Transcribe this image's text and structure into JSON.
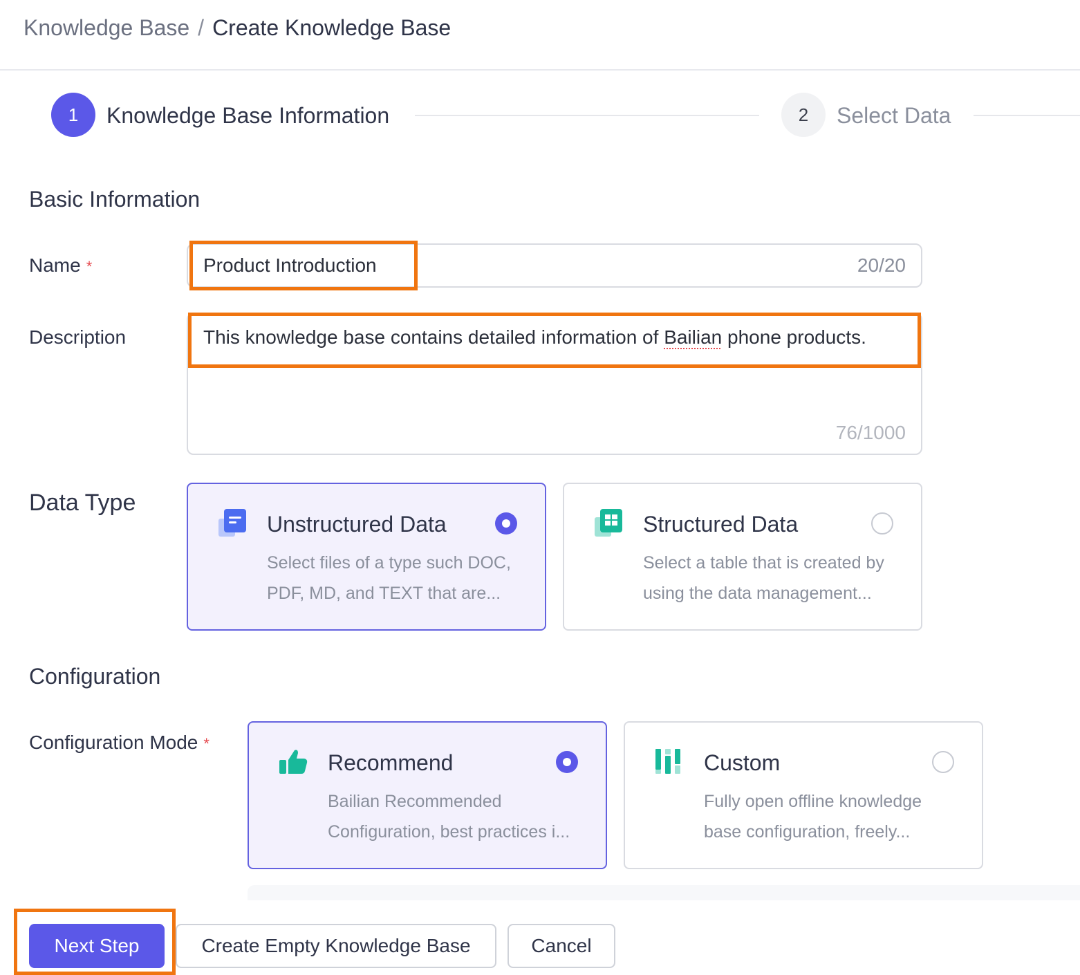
{
  "breadcrumb": {
    "parent": "Knowledge Base",
    "separator": "/",
    "current": "Create Knowledge Base"
  },
  "steps": [
    {
      "number": "1",
      "label": "Knowledge Base Information"
    },
    {
      "number": "2",
      "label": "Select Data"
    }
  ],
  "basic_info": {
    "title": "Basic Information",
    "name_label": "Name",
    "required_mark": "*",
    "name_value": "Product Introduction",
    "name_count": "20/20",
    "description_label": "Description",
    "description_before": "This knowledge base contains detailed information of ",
    "description_misspelled": "Bailian",
    "description_after": " phone products.",
    "description_count": "76/1000"
  },
  "data_type": {
    "title": "Data Type",
    "options": [
      {
        "title": "Unstructured Data",
        "desc_line1": "Select files of a type such DOC,",
        "desc_line2": "PDF, MD, and TEXT that are...",
        "selected": true,
        "icon": "document-icon"
      },
      {
        "title": "Structured Data",
        "desc_line1": "Select a table that is created by",
        "desc_line2": "using the data management...",
        "selected": false,
        "icon": "table-icon"
      }
    ]
  },
  "configuration": {
    "title": "Configuration",
    "mode_label": "Configuration Mode",
    "options": [
      {
        "title": "Recommend",
        "desc_line1": "Bailian Recommended",
        "desc_line2": "Configuration, best practices i...",
        "selected": true,
        "icon": "thumbs-up-icon"
      },
      {
        "title": "Custom",
        "desc_line1": "Fully open offline knowledge",
        "desc_line2": "base configuration, freely...",
        "selected": false,
        "icon": "sliders-icon"
      }
    ]
  },
  "buttons": {
    "next": "Next Step",
    "create_empty": "Create Empty Knowledge Base",
    "cancel": "Cancel"
  },
  "colors": {
    "primary": "#5b58e8",
    "highlight": "#f07510",
    "selected_bg": "#f3f1fd",
    "required": "#e5484d"
  }
}
